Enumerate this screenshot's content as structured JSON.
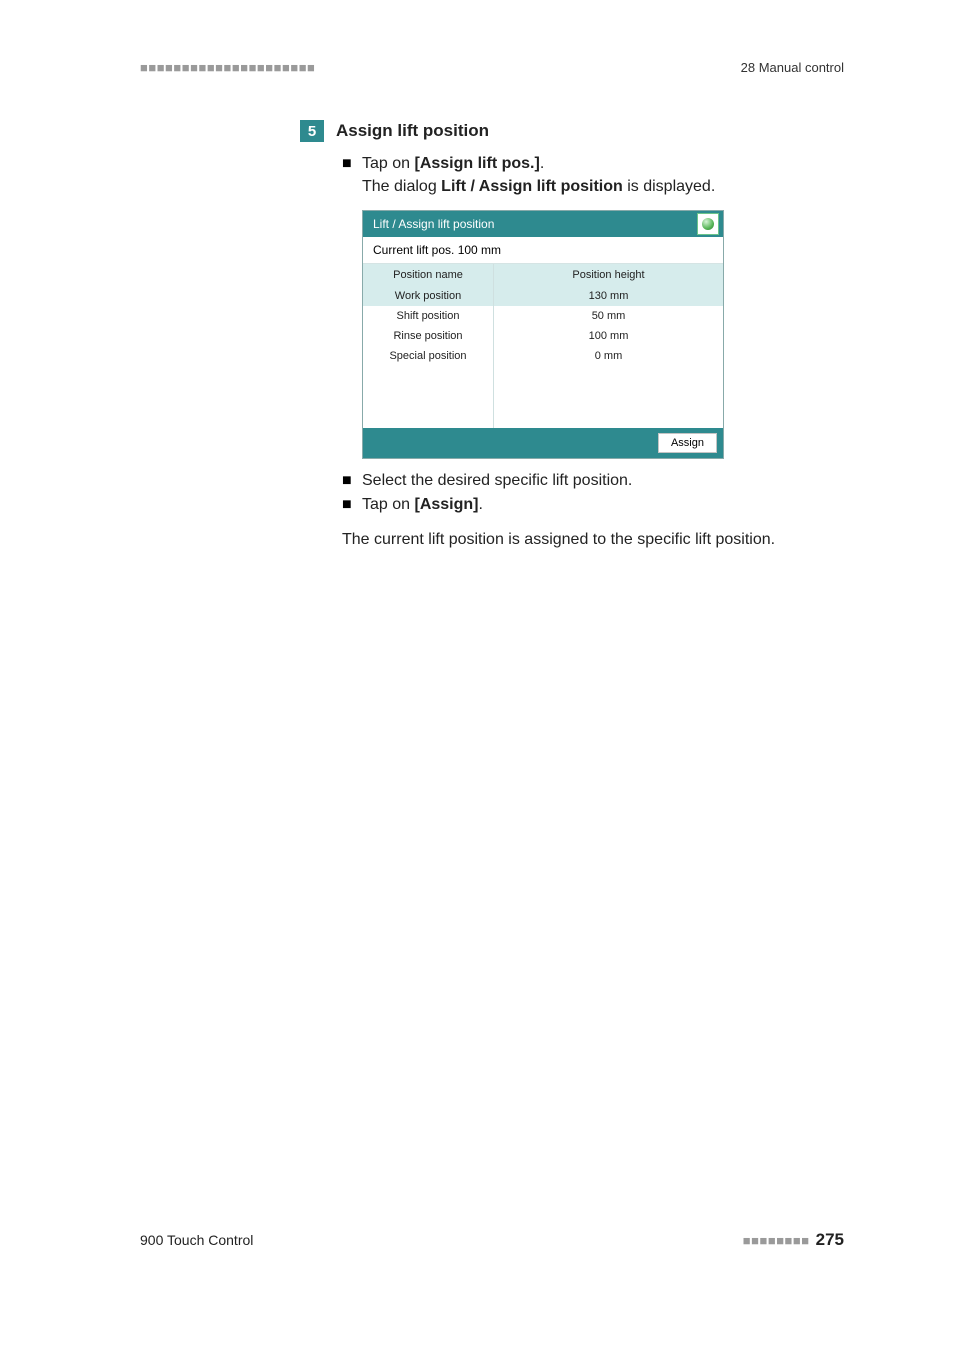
{
  "header": {
    "left_dashes": "■■■■■■■■■■■■■■■■■■■■■",
    "right": "28 Manual control"
  },
  "step": {
    "number": "5",
    "title": "Assign lift position"
  },
  "bullets1": {
    "tap_on_prefix": "Tap on ",
    "button": "[Assign lift pos.]",
    "period": ".",
    "dialog_prefix": "The dialog ",
    "dialog_name": "Lift / Assign lift position",
    "dialog_suffix": " is displayed."
  },
  "dialog": {
    "title": "Lift / Assign lift position",
    "subtitle": "Current lift pos. 100 mm",
    "col1": "Position name",
    "col2": "Position height",
    "rows": [
      {
        "name": "Work position",
        "height": "130 mm",
        "selected": true
      },
      {
        "name": "Shift position",
        "height": "50 mm",
        "selected": false
      },
      {
        "name": "Rinse position",
        "height": "100 mm",
        "selected": false
      },
      {
        "name": "Special position",
        "height": "0 mm",
        "selected": false
      }
    ],
    "assign": "Assign"
  },
  "bullets2": {
    "select": "Select the desired specific lift position.",
    "tap_on_prefix": "Tap on ",
    "button": "[Assign]",
    "period": "."
  },
  "para": "The current lift position is assigned to the specific lift position.",
  "footer": {
    "left": "900 Touch Control",
    "dashes": "■■■■■■■■",
    "page": "275"
  }
}
